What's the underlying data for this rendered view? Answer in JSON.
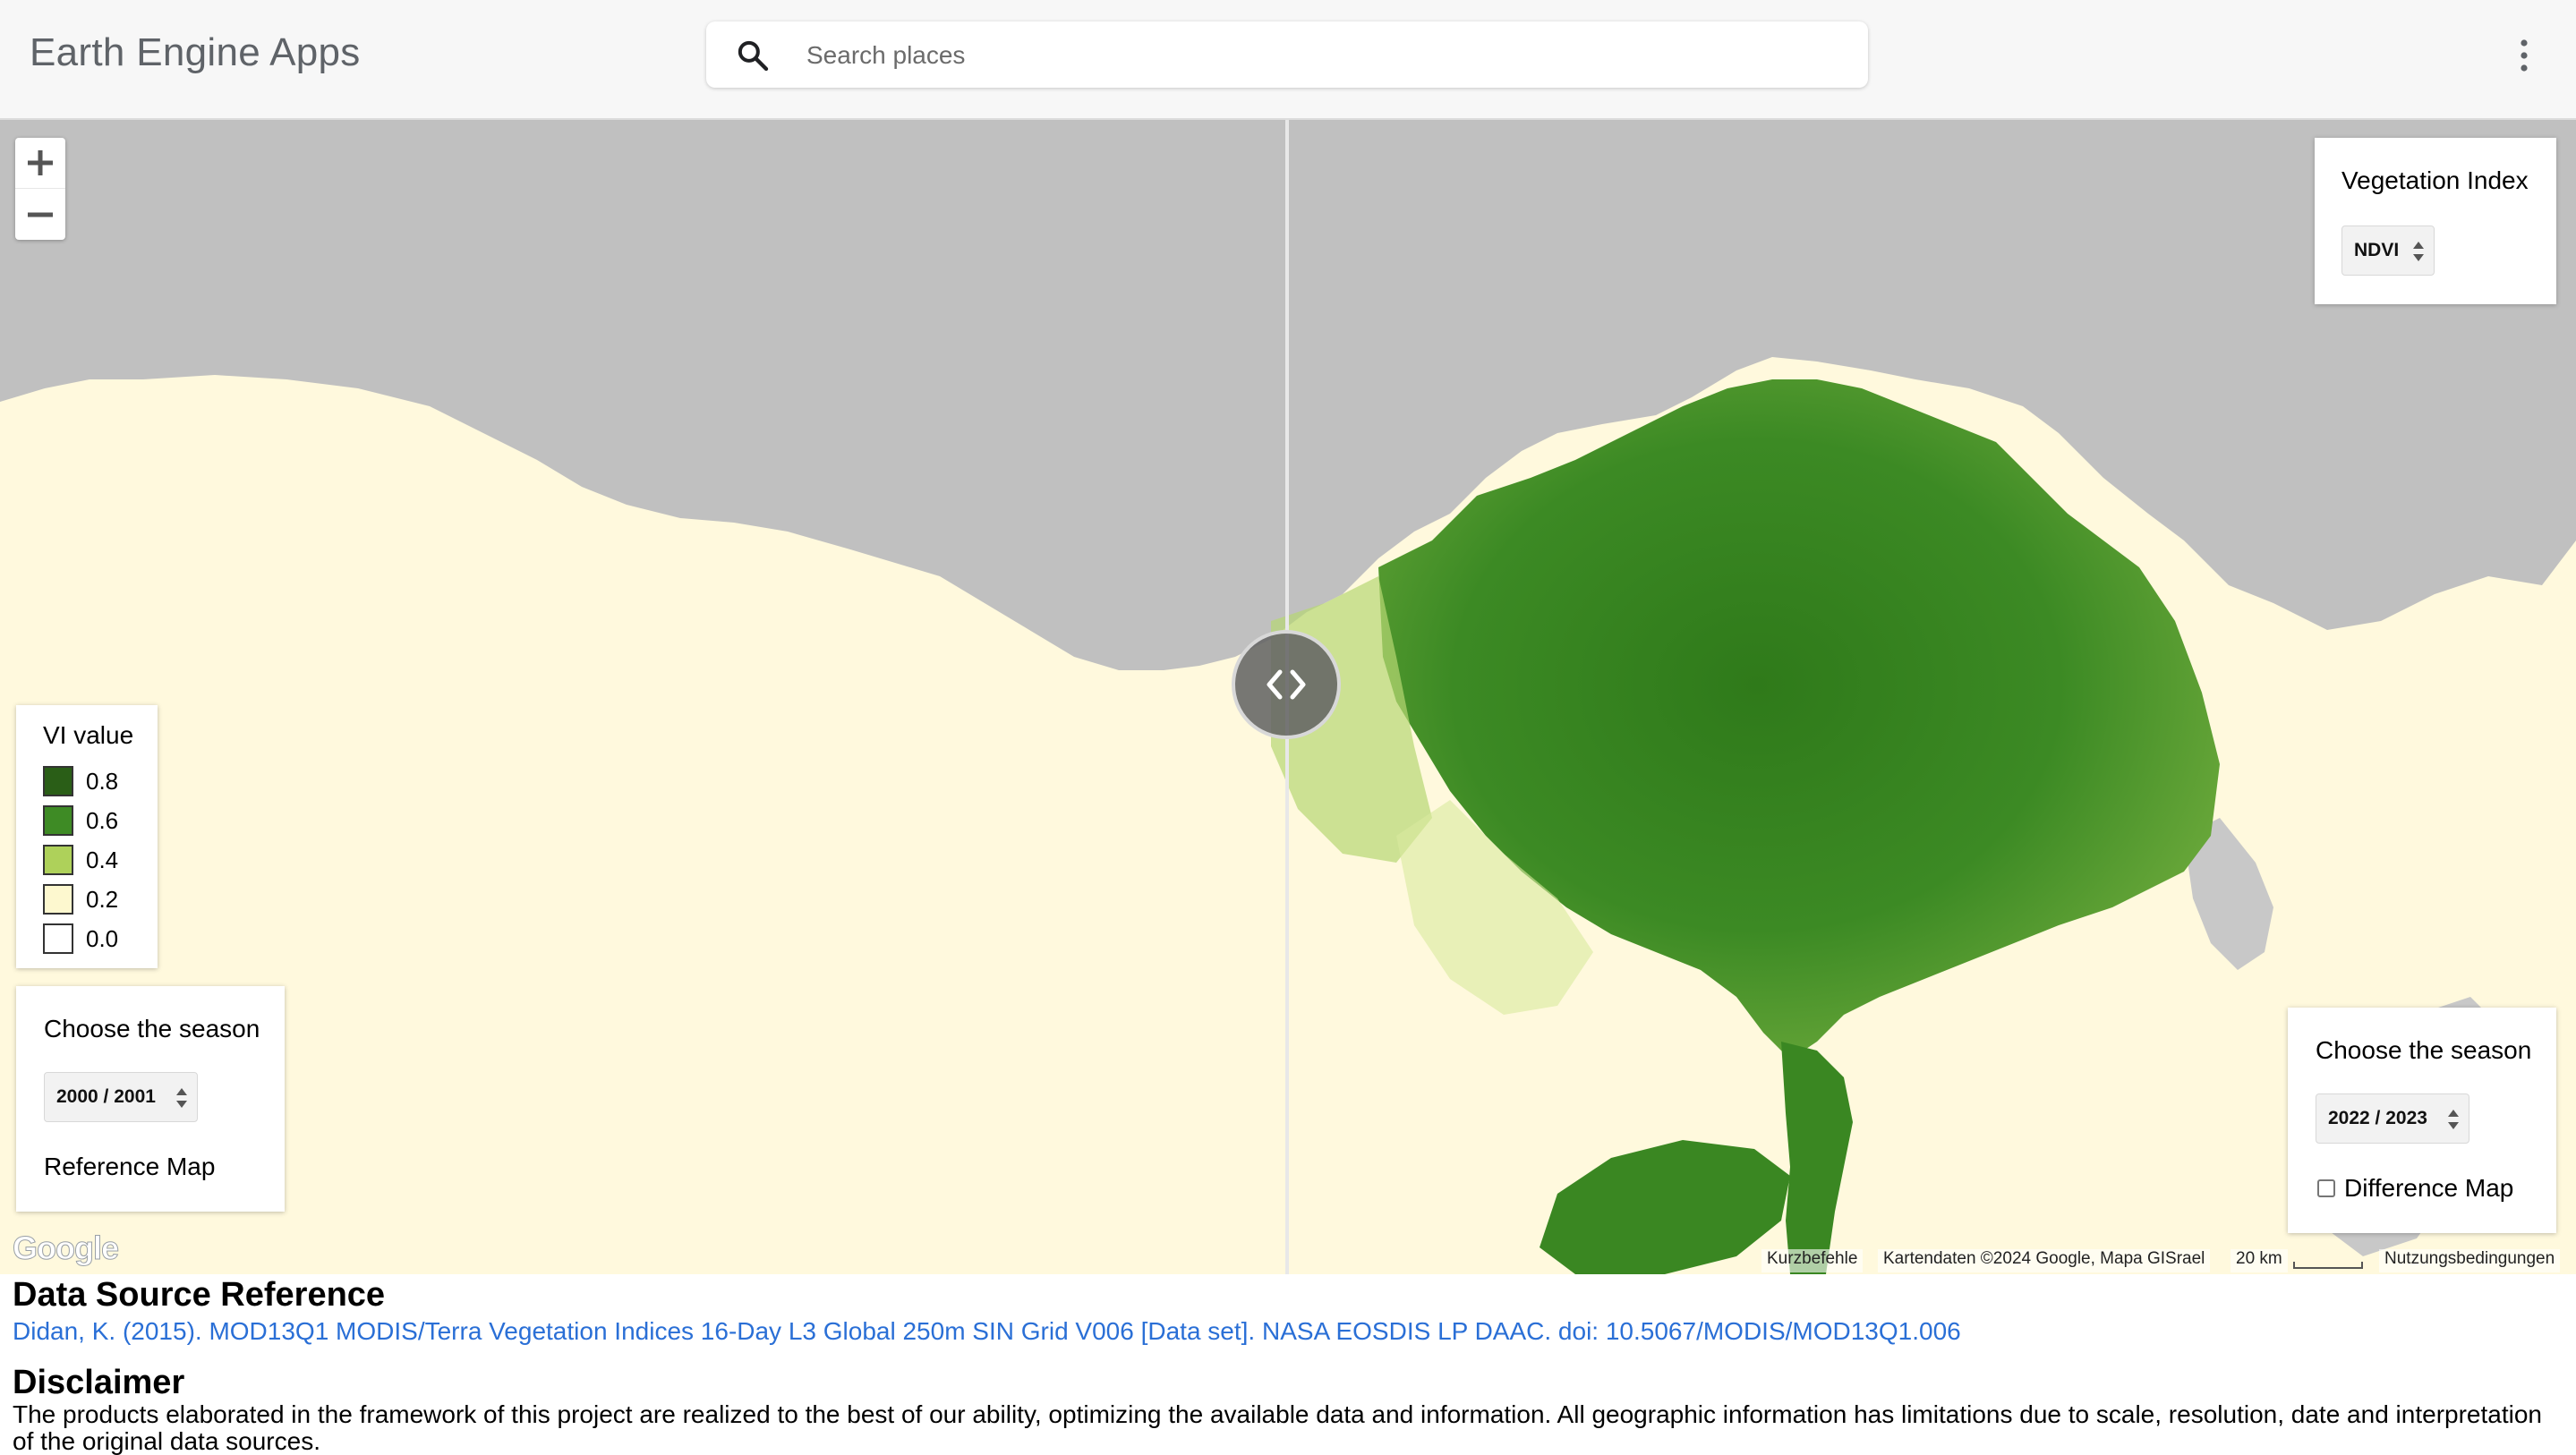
{
  "header": {
    "app_title": "Earth Engine Apps",
    "search_placeholder": "Search places",
    "search_value": "",
    "menu_icon": "more-vert-icon"
  },
  "map": {
    "zoom_in_icon": "plus-icon",
    "zoom_out_icon": "minus-icon",
    "swipe_handle_icon": "chevron-left-right-icon",
    "google_logo": "Google",
    "attribution": {
      "shortcuts": "Kurzbefehle",
      "map_data": "Kartendaten ©2024 Google, Mapa GISrael",
      "scale": "20 km",
      "terms": "Nutzungsbedingungen"
    },
    "colors": {
      "sea": "#c0c0c0",
      "desert": "#fff9dd",
      "vegetation_dense": "#2f7d1c",
      "vegetation_mid": "#5a9e2c"
    }
  },
  "vegetation_index_panel": {
    "title": "Vegetation Index",
    "selected": "NDVI"
  },
  "legend": {
    "title": "VI value",
    "items": [
      {
        "label": "0.8",
        "color": "#2a5e17"
      },
      {
        "label": "0.6",
        "color": "#3e8b25"
      },
      {
        "label": "0.4",
        "color": "#aed15a"
      },
      {
        "label": "0.2",
        "color": "#fdf8cf"
      },
      {
        "label": "0.0",
        "color": "#ffffff"
      }
    ]
  },
  "left_season_panel": {
    "label": "Choose the season",
    "selected": "2000 / 2001",
    "caption": "Reference Map"
  },
  "right_season_panel": {
    "label": "Choose the season",
    "selected": "2022 / 2023",
    "difference_label": "Difference Map",
    "difference_checked": false
  },
  "footer": {
    "data_source_heading": "Data Source Reference",
    "data_source_link": "Didan, K. (2015). MOD13Q1 MODIS/Terra Vegetation Indices 16-Day L3 Global 250m SIN Grid V006 [Data set]. NASA EOSDIS LP DAAC. doi: 10.5067/MODIS/MOD13Q1.006",
    "disclaimer_heading": "Disclaimer",
    "disclaimer_text": "The products elaborated in the framework of this project are realized to the best of our ability, optimizing the available data and information. All geographic information has limitations due to scale, resolution, date and interpretation of the original data sources."
  }
}
